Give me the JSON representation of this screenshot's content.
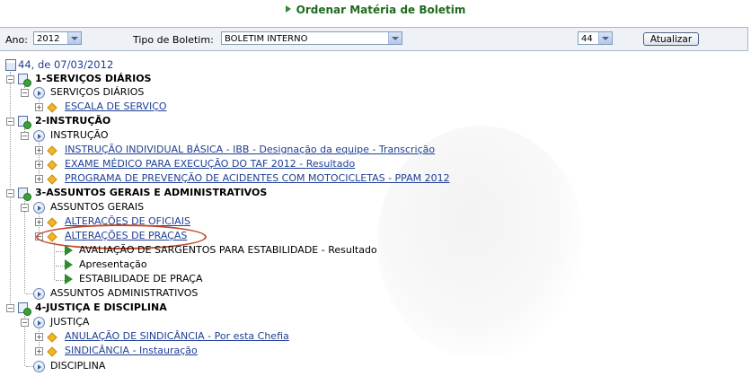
{
  "page": {
    "title": "Ordenar Matéria de Boletim"
  },
  "filters": {
    "ano_label": "Ano:",
    "ano_value": "2012",
    "tipo_label": "Tipo de Boletim:",
    "tipo_value": "BOLETIM INTERNO",
    "numero_value": "44",
    "update_button": "Atualizar"
  },
  "tree": {
    "root": "44, de 07/03/2012",
    "s1": {
      "title": "1-SERVIÇOS DIÁRIOS",
      "sub": "SERVIÇOS DIÁRIOS",
      "items": [
        "ESCALA DE SERVIÇO"
      ]
    },
    "s2": {
      "title": "2-INSTRUÇÃO",
      "sub": "INSTRUÇÃO",
      "items": [
        "INSTRUÇÃO INDIVIDUAL BÁSICA - IBB - Designação da equipe - Transcrição",
        "EXAME MÉDICO PARA EXECUÇÃO DO TAF 2012 - Resultado",
        "PROGRAMA DE PREVENÇÃO DE ACIDENTES COM MOTOCICLETAS - PPAM 2012"
      ]
    },
    "s3": {
      "title": "3-ASSUNTOS GERAIS E ADMINISTRATIVOS",
      "sub": "ASSUNTOS GERAIS",
      "items": [
        "ALTERAÇÕES DE OFICIAIS",
        "ALTERAÇÕES DE PRAÇAS"
      ],
      "leaves": [
        "AVALIAÇÃO DE SARGENTOS PARA ESTABILIDADE - Resultado",
        "Apresentação",
        "ESTABILIDADE DE PRAÇA"
      ],
      "sub2": "ASSUNTOS ADMINISTRATIVOS"
    },
    "s4": {
      "title": "4-JUSTIÇA E DISCIPLINA",
      "sub": "JUSTIÇA",
      "items": [
        "ANULAÇÃO DE SINDICÂNCIA - Por esta Chefia",
        "SINDICÂNCIA - Instauração"
      ],
      "sub2": "DISCIPLINA"
    }
  },
  "icons": {
    "accent": "#2e8b2e",
    "link": "#1f3f96",
    "highlight": "#c04a2a"
  }
}
